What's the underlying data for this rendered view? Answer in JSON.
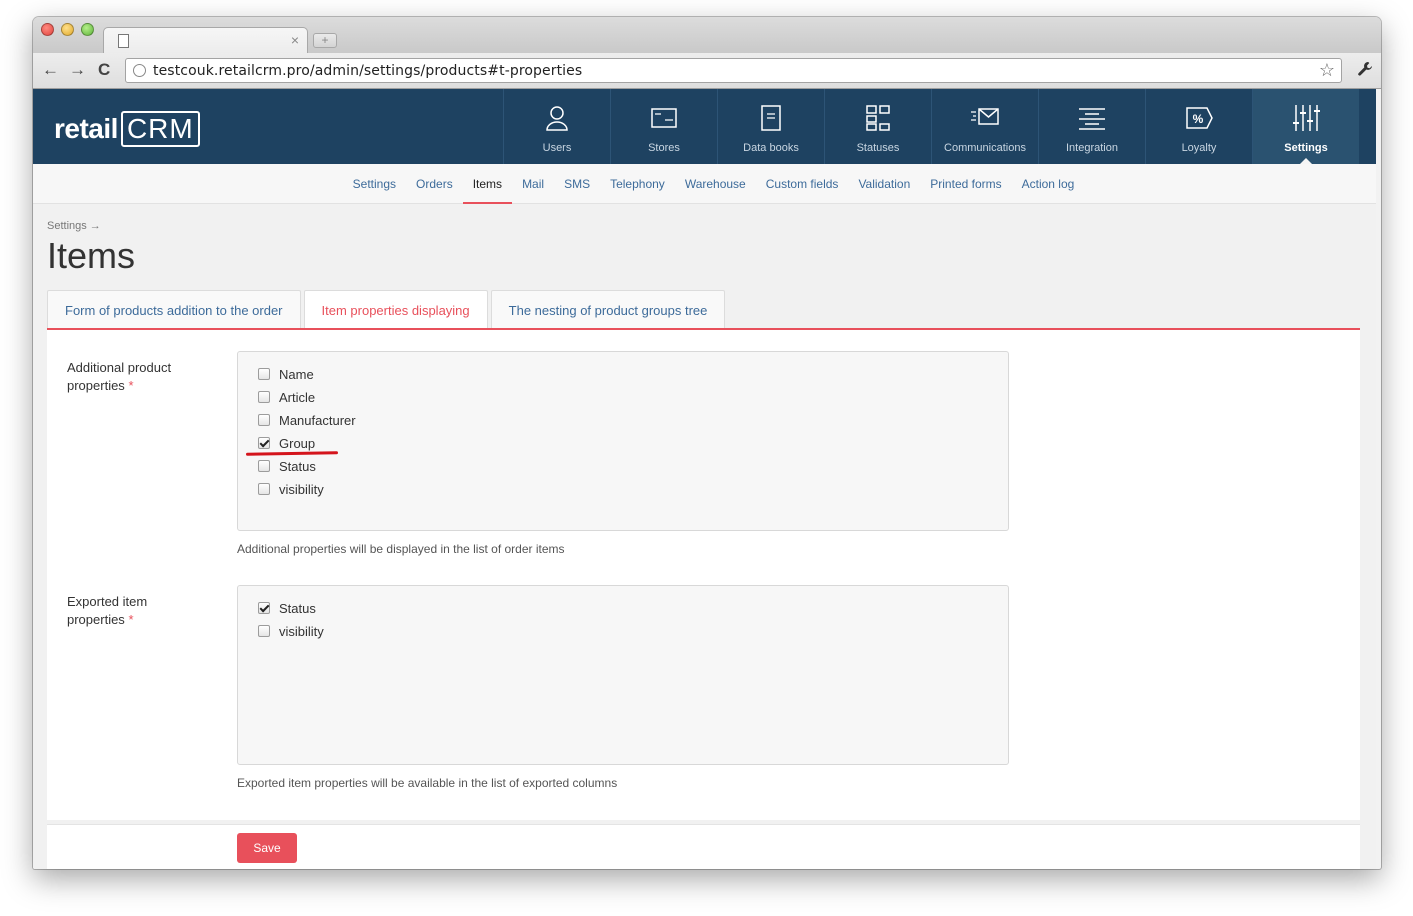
{
  "browser": {
    "url": "testcouk.retailcrm.pro/admin/settings/products#t-properties",
    "tab_close": "×",
    "new_tab": "+",
    "back": "←",
    "forward": "→",
    "reload": "C",
    "star": "☆",
    "wrench": "🔧"
  },
  "app": {
    "logo_prefix": "retail",
    "logo_suffix": "CRM",
    "nav": [
      {
        "label": "Users",
        "icon": "user-icon"
      },
      {
        "label": "Stores",
        "icon": "store-icon"
      },
      {
        "label": "Data books",
        "icon": "book-icon"
      },
      {
        "label": "Statuses",
        "icon": "statuses-icon"
      },
      {
        "label": "Communications",
        "icon": "mail-icon"
      },
      {
        "label": "Integration",
        "icon": "integration-icon"
      },
      {
        "label": "Loyalty",
        "icon": "percent-icon"
      },
      {
        "label": "Settings",
        "icon": "sliders-icon",
        "active": true
      }
    ],
    "subnav": [
      "Settings",
      "Orders",
      "Items",
      "Mail",
      "SMS",
      "Telephony",
      "Warehouse",
      "Custom fields",
      "Validation",
      "Printed forms",
      "Action log"
    ],
    "subnav_active": "Items"
  },
  "page": {
    "breadcrumb": "Settings →",
    "title": "Items",
    "tabs": [
      {
        "label": "Form of products addition to the order",
        "active": false
      },
      {
        "label": "Item properties displaying",
        "active": true
      },
      {
        "label": "The nesting of product groups tree",
        "active": false
      }
    ]
  },
  "form": {
    "additional": {
      "label": "Additional product properties",
      "required_mark": "*",
      "options": [
        {
          "label": "Name",
          "checked": false
        },
        {
          "label": "Article",
          "checked": false
        },
        {
          "label": "Manufacturer",
          "checked": false
        },
        {
          "label": "Group",
          "checked": true
        },
        {
          "label": "Status",
          "checked": false
        },
        {
          "label": "visibility",
          "checked": false
        }
      ],
      "hint": "Additional properties will be displayed in the list of order items"
    },
    "exported": {
      "label": "Exported item properties",
      "required_mark": "*",
      "options": [
        {
          "label": "Status",
          "checked": true
        },
        {
          "label": "visibility",
          "checked": false
        }
      ],
      "hint": "Exported item properties will be available in the list of exported columns"
    },
    "save_label": "Save"
  },
  "colors": {
    "header_bg": "#1e4261",
    "accent": "#e8505b",
    "link": "#3d6b9a",
    "annotation": "#d4141c"
  }
}
